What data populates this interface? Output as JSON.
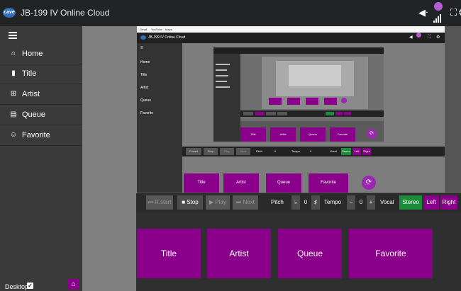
{
  "app": {
    "title": "JB-199 IV Online Cloud",
    "logo_text": "cave"
  },
  "topbar_icons": {
    "volume": "volume-icon",
    "mic": "microphone-icon",
    "fullscreen": "fullscreen-icon",
    "settings": "gear-icon"
  },
  "sidebar": {
    "items": [
      {
        "label": "Home",
        "icon": "home-icon",
        "glyph": "⌂"
      },
      {
        "label": "Title",
        "icon": "book-icon",
        "glyph": "▮"
      },
      {
        "label": "Artist",
        "icon": "grid-icon",
        "glyph": "⊞"
      },
      {
        "label": "Queue",
        "icon": "list-icon",
        "glyph": "▤"
      },
      {
        "label": "Favorite",
        "icon": "users-icon",
        "glyph": "☺"
      }
    ],
    "footer": {
      "desktop_label": "Desktop",
      "desktop_checked": true
    }
  },
  "controls": {
    "restart": "R.start",
    "stop": "Stop",
    "play": "Play",
    "next": "Next",
    "pitch_label": "Pitch",
    "pitch_flat": "♭",
    "pitch_value": "0",
    "pitch_sharp": "♯",
    "tempo_label": "Tempo",
    "tempo_minus": "−",
    "tempo_value": "0",
    "tempo_plus": "+",
    "vocal_label": "Vocal",
    "stereo": "Stereo",
    "left": "Left",
    "right": "Right"
  },
  "tiles": [
    "Title",
    "Artist",
    "Queue",
    "Favorite"
  ],
  "colors": {
    "accent": "#8b008b",
    "stereo": "#1a8c3a",
    "topbar": "#222324",
    "sidebar": "#3a3a3a"
  },
  "l1": {
    "browser_tabs": [
      "Gmail",
      "YouTube",
      "Maps"
    ],
    "title": "JB-199 IV Online Cloud",
    "sidebar": [
      "Home",
      "Title",
      "Artist",
      "Queue",
      "Favorite"
    ],
    "tiles": [
      "Title",
      "Artist",
      "Queue",
      "Favorite"
    ],
    "controls": [
      "R.start",
      "Stop",
      "Play",
      "Next",
      "Pitch",
      "0",
      "Tempo",
      "0",
      "Vocal",
      "Stereo",
      "Left",
      "Right"
    ]
  }
}
